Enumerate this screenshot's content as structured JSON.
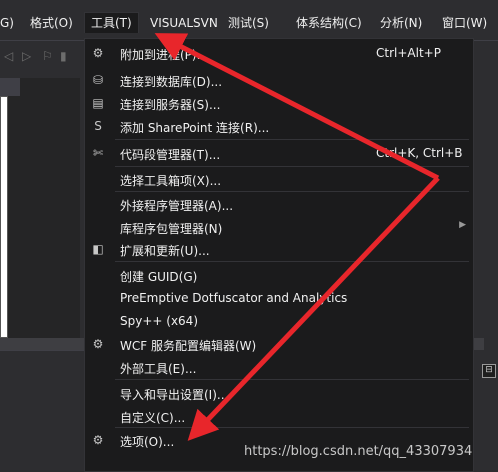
{
  "menubar": {
    "items": [
      {
        "label": "G)"
      },
      {
        "label": "格式(O)"
      },
      {
        "label": "工具(T)"
      },
      {
        "label": "VISUALSVN"
      },
      {
        "label": "测试(S)"
      },
      {
        "label": "体系结构(C)"
      },
      {
        "label": "分析(N)"
      },
      {
        "label": "窗口(W)"
      }
    ]
  },
  "menu": {
    "items": [
      {
        "label": "附加到进程(P)...",
        "shortcut": "Ctrl+Alt+P",
        "icon": "attach-process-icon"
      },
      {
        "label": "连接到数据库(D)...",
        "shortcut": "",
        "icon": "database-connect-icon"
      },
      {
        "label": "连接到服务器(S)...",
        "shortcut": "",
        "icon": "server-connect-icon"
      },
      {
        "label": "添加 SharePoint 连接(R)...",
        "shortcut": "",
        "icon": "sharepoint-icon"
      },
      {
        "label": "代码段管理器(T)...",
        "shortcut": "Ctrl+K, Ctrl+B",
        "icon": "code-snippet-icon"
      },
      {
        "label": "选择工具箱项(X)...",
        "shortcut": "",
        "icon": ""
      },
      {
        "label": "外接程序管理器(A)...",
        "shortcut": "",
        "icon": ""
      },
      {
        "label": "库程序包管理器(N)",
        "shortcut": "",
        "icon": "",
        "submenu": true
      },
      {
        "label": "扩展和更新(U)...",
        "shortcut": "",
        "icon": "extensions-icon"
      },
      {
        "label": "创建 GUID(G)",
        "shortcut": "",
        "icon": ""
      },
      {
        "label": "PreEmptive Dotfuscator and Analytics",
        "shortcut": "",
        "icon": ""
      },
      {
        "label": "Spy++ (x64)",
        "shortcut": "",
        "icon": ""
      },
      {
        "label": "WCF 服务配置编辑器(W)",
        "shortcut": "",
        "icon": "gear-icon"
      },
      {
        "label": "外部工具(E)...",
        "shortcut": "",
        "icon": ""
      },
      {
        "label": "导入和导出设置(I)...",
        "shortcut": "",
        "icon": ""
      },
      {
        "label": "自定义(C)...",
        "shortcut": "",
        "icon": ""
      },
      {
        "label": "选项(O)...",
        "shortcut": "",
        "icon": "gear-icon"
      }
    ]
  },
  "watermark": "https://blog.csdn.net/qq_43307934",
  "colors": {
    "arrow": "#e8262b",
    "menu_bg": "#1b1b1c",
    "text": "#f1f1f1"
  }
}
